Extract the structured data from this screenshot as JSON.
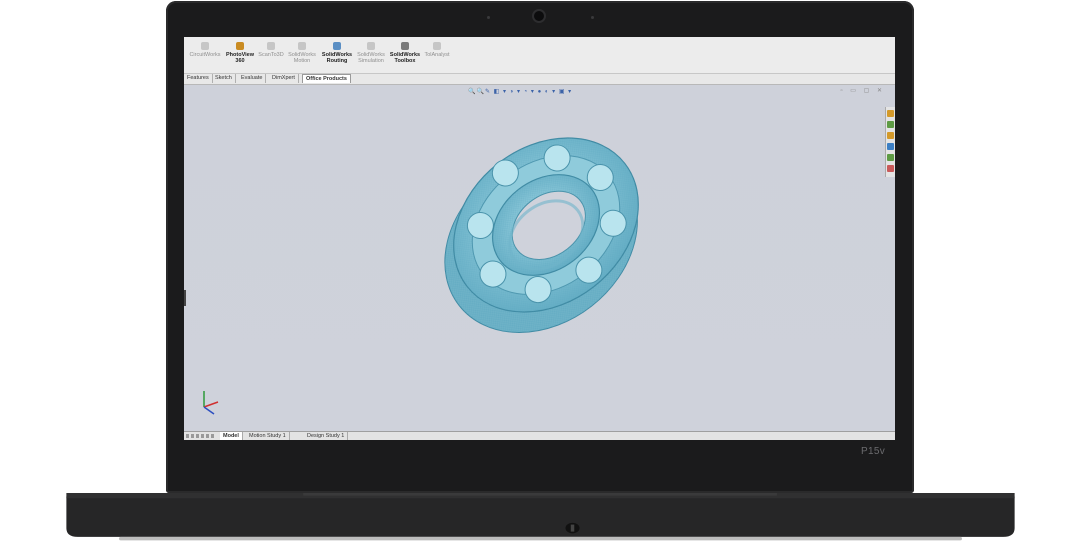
{
  "device": {
    "model_label": "P15v"
  },
  "ribbon": {
    "items": [
      {
        "label": "CircuitWorks",
        "active": false
      },
      {
        "label": "PhotoView 360",
        "active": true
      },
      {
        "label": "ScanTo3D",
        "active": false
      },
      {
        "label": "SolidWorks Motion",
        "active": false
      },
      {
        "label": "SolidWorks Routing",
        "active": true
      },
      {
        "label": "SolidWorks Simulation",
        "active": false
      },
      {
        "label": "SolidWorks Toolbox",
        "active": true
      },
      {
        "label": "TolAnalyst",
        "active": false
      }
    ]
  },
  "command_tabs": [
    "Features",
    "Sketch",
    "Evaluate",
    "DimXpert",
    "Office Products"
  ],
  "command_tabs_active": "Office Products",
  "bottom_tabs": [
    "Model",
    "Motion Study 1",
    "Design Study 1"
  ],
  "bottom_tabs_active": "Model",
  "colors": {
    "viewport_bg": "#d0d3dc",
    "model_tint": "#7fc3d6",
    "ribbon_active_icon": "#c98b22",
    "bezel": "#1b1b1c"
  },
  "viewport": {
    "model": "ball-bearing"
  }
}
